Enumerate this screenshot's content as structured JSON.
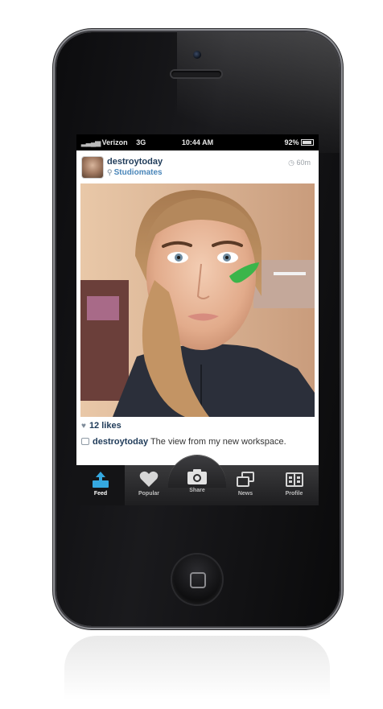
{
  "status_bar": {
    "carrier": "Verizon",
    "network": "3G",
    "time": "10:44 AM",
    "battery": "92%"
  },
  "post": {
    "username": "destroytoday",
    "location": "Studiomates",
    "time_ago": "60m",
    "likes": "12 likes",
    "caption_user": "destroytoday",
    "caption_text": "The view from my new workspace."
  },
  "tab_bar": [
    {
      "label": "Feed",
      "icon": "feed-icon",
      "active": true
    },
    {
      "label": "Popular",
      "icon": "heart-icon",
      "active": false
    },
    {
      "label": "Share",
      "icon": "camera-icon",
      "active": false
    },
    {
      "label": "News",
      "icon": "news-icon",
      "active": false
    },
    {
      "label": "Profile",
      "icon": "profile-icon",
      "active": false
    }
  ],
  "colors": {
    "username_blue": "#1f3b59",
    "location_blue": "#4a86b9",
    "active_tab_accent": "#35a8e0",
    "face_paint_green": "#3bb54a"
  }
}
